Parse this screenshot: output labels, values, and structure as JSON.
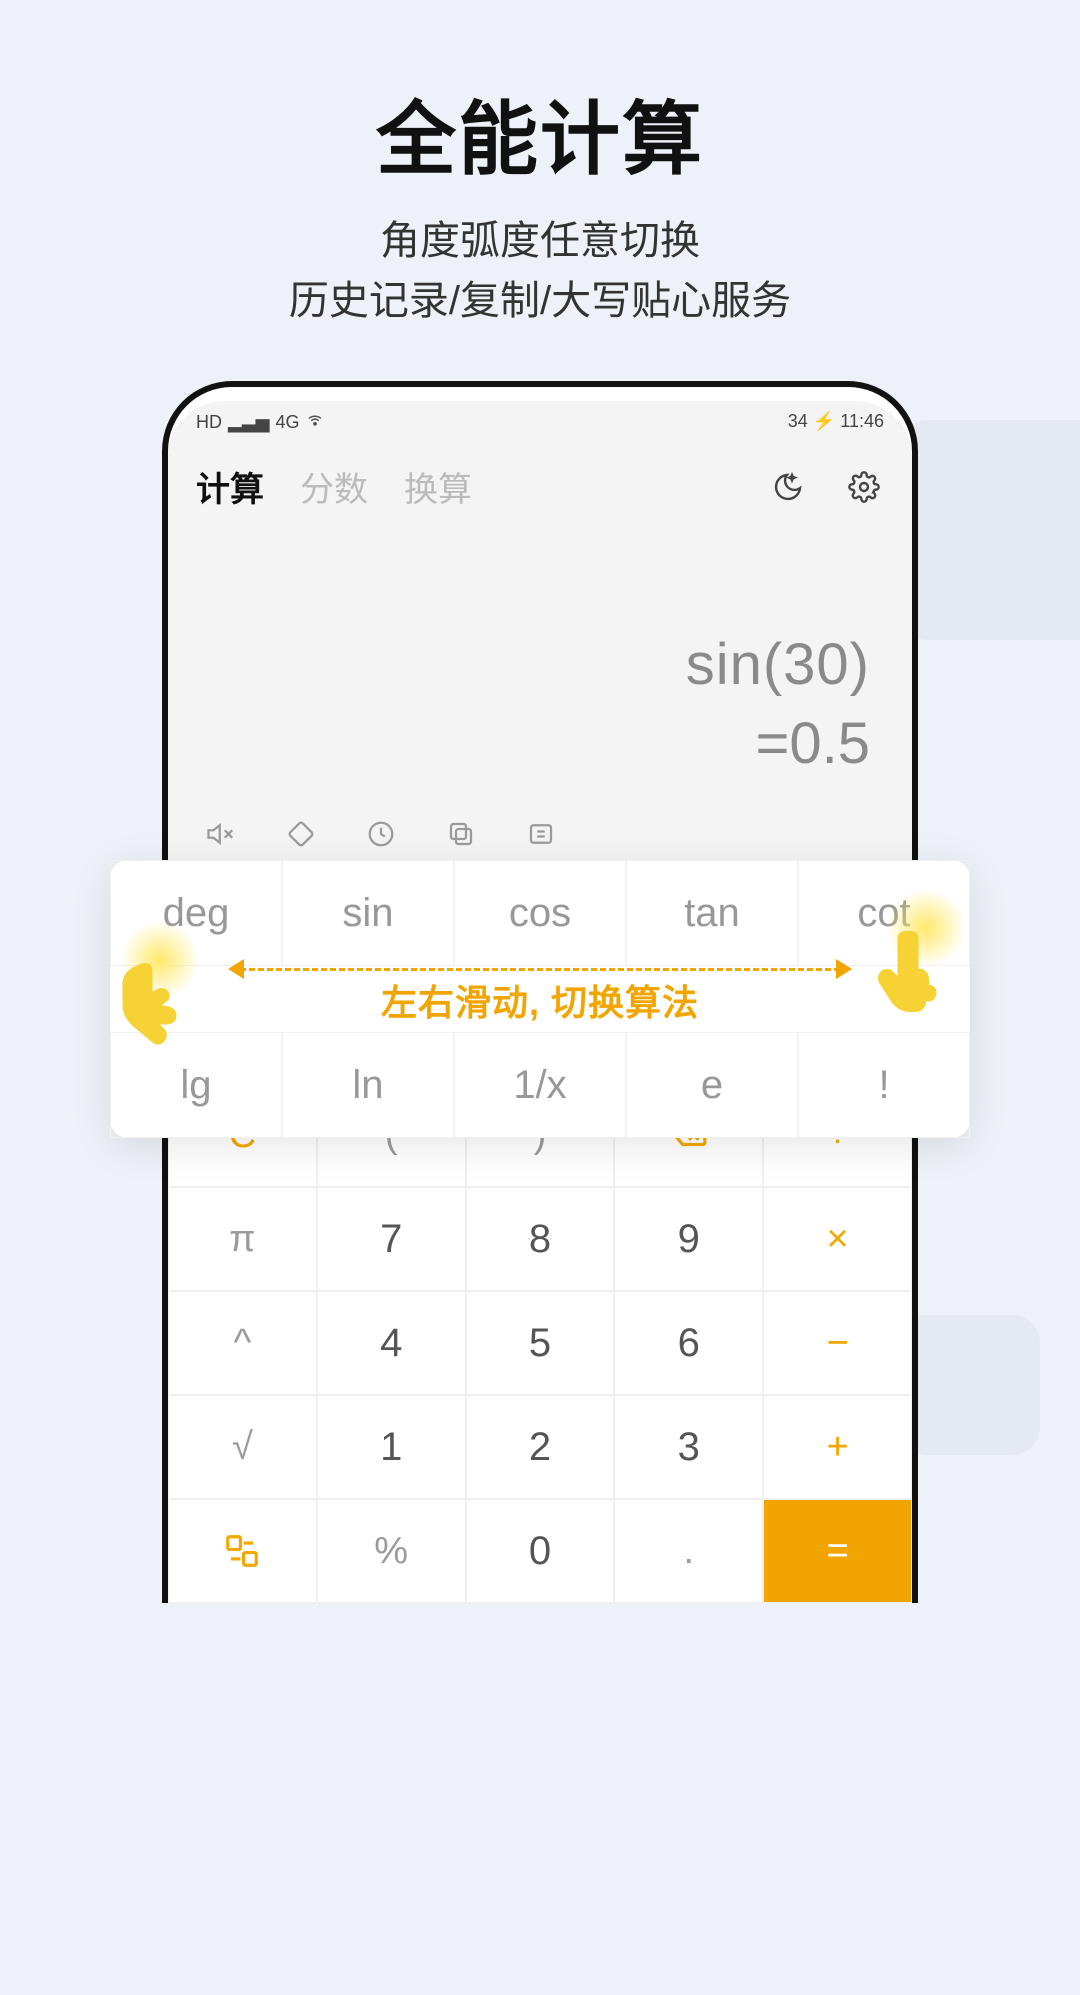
{
  "promo": {
    "title": "全能计算",
    "subtitle_line1": "角度弧度任意切换",
    "subtitle_line2": "历史记录/复制/大写贴心服务"
  },
  "statusbar": {
    "hd_label": "HD",
    "signal_label": "4G",
    "battery": "34",
    "time": "11:46"
  },
  "tabs": {
    "calc": "计算",
    "fraction": "分数",
    "convert": "换算"
  },
  "header_icons": {
    "night": "moon-star-icon",
    "settings": "gear-icon"
  },
  "display": {
    "expression": "sin(30)",
    "result": "=0.5"
  },
  "toolbar": {
    "mute": "sound-off-icon",
    "rotate": "rotate-icon",
    "history": "history-icon",
    "copy": "copy-icon",
    "capital": "to-capital-icon"
  },
  "overlay": {
    "row1": [
      "deg",
      "sin",
      "cos",
      "tan",
      "cot"
    ],
    "row2": [
      "lg",
      "ln",
      "1/x",
      "e",
      "!"
    ],
    "hint": "左右滑动, 切换算法"
  },
  "keypad": {
    "row1": [
      "C",
      "(",
      ")",
      "⌫",
      "÷"
    ],
    "row2": [
      "π",
      "7",
      "8",
      "9",
      "×"
    ],
    "row3": [
      "^",
      "4",
      "5",
      "6",
      "−"
    ],
    "row4": [
      "√",
      "1",
      "2",
      "3",
      "+"
    ],
    "row5": [
      "⇆",
      "%",
      "0",
      ".",
      "="
    ]
  },
  "colors": {
    "accent": "#f2a800"
  }
}
